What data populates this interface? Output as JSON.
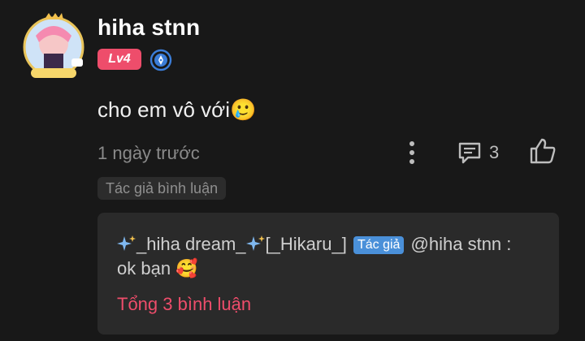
{
  "comment": {
    "username": "hiha stnn",
    "level": "Lv4",
    "text": "cho em vô với",
    "text_emoji": "🥲",
    "timestamp": "1 ngày trước",
    "reply_count": "3",
    "author_tag": "Tác giả bình luận"
  },
  "reply": {
    "author_prefix": "_hiha dream_",
    "author_suffix": "[_Hikaru_]",
    "author_badge": "Tác giả",
    "mention": "@hiha stnn :",
    "text": "ok bạn",
    "emoji": "🥰",
    "total_link": "Tổng 3 bình luận"
  },
  "colors": {
    "background": "#181818",
    "accent_pink": "#ee4d6b",
    "author_badge_blue": "#4a90d9",
    "verify_blue": "#3b7dd8"
  },
  "icons": {
    "avatar": "anime-avatar",
    "verify": "verified-pen-icon",
    "more": "more-vertical-icon",
    "reply": "comment-icon",
    "like": "thumbs-up-icon",
    "sparkle": "sparkles-icon"
  }
}
